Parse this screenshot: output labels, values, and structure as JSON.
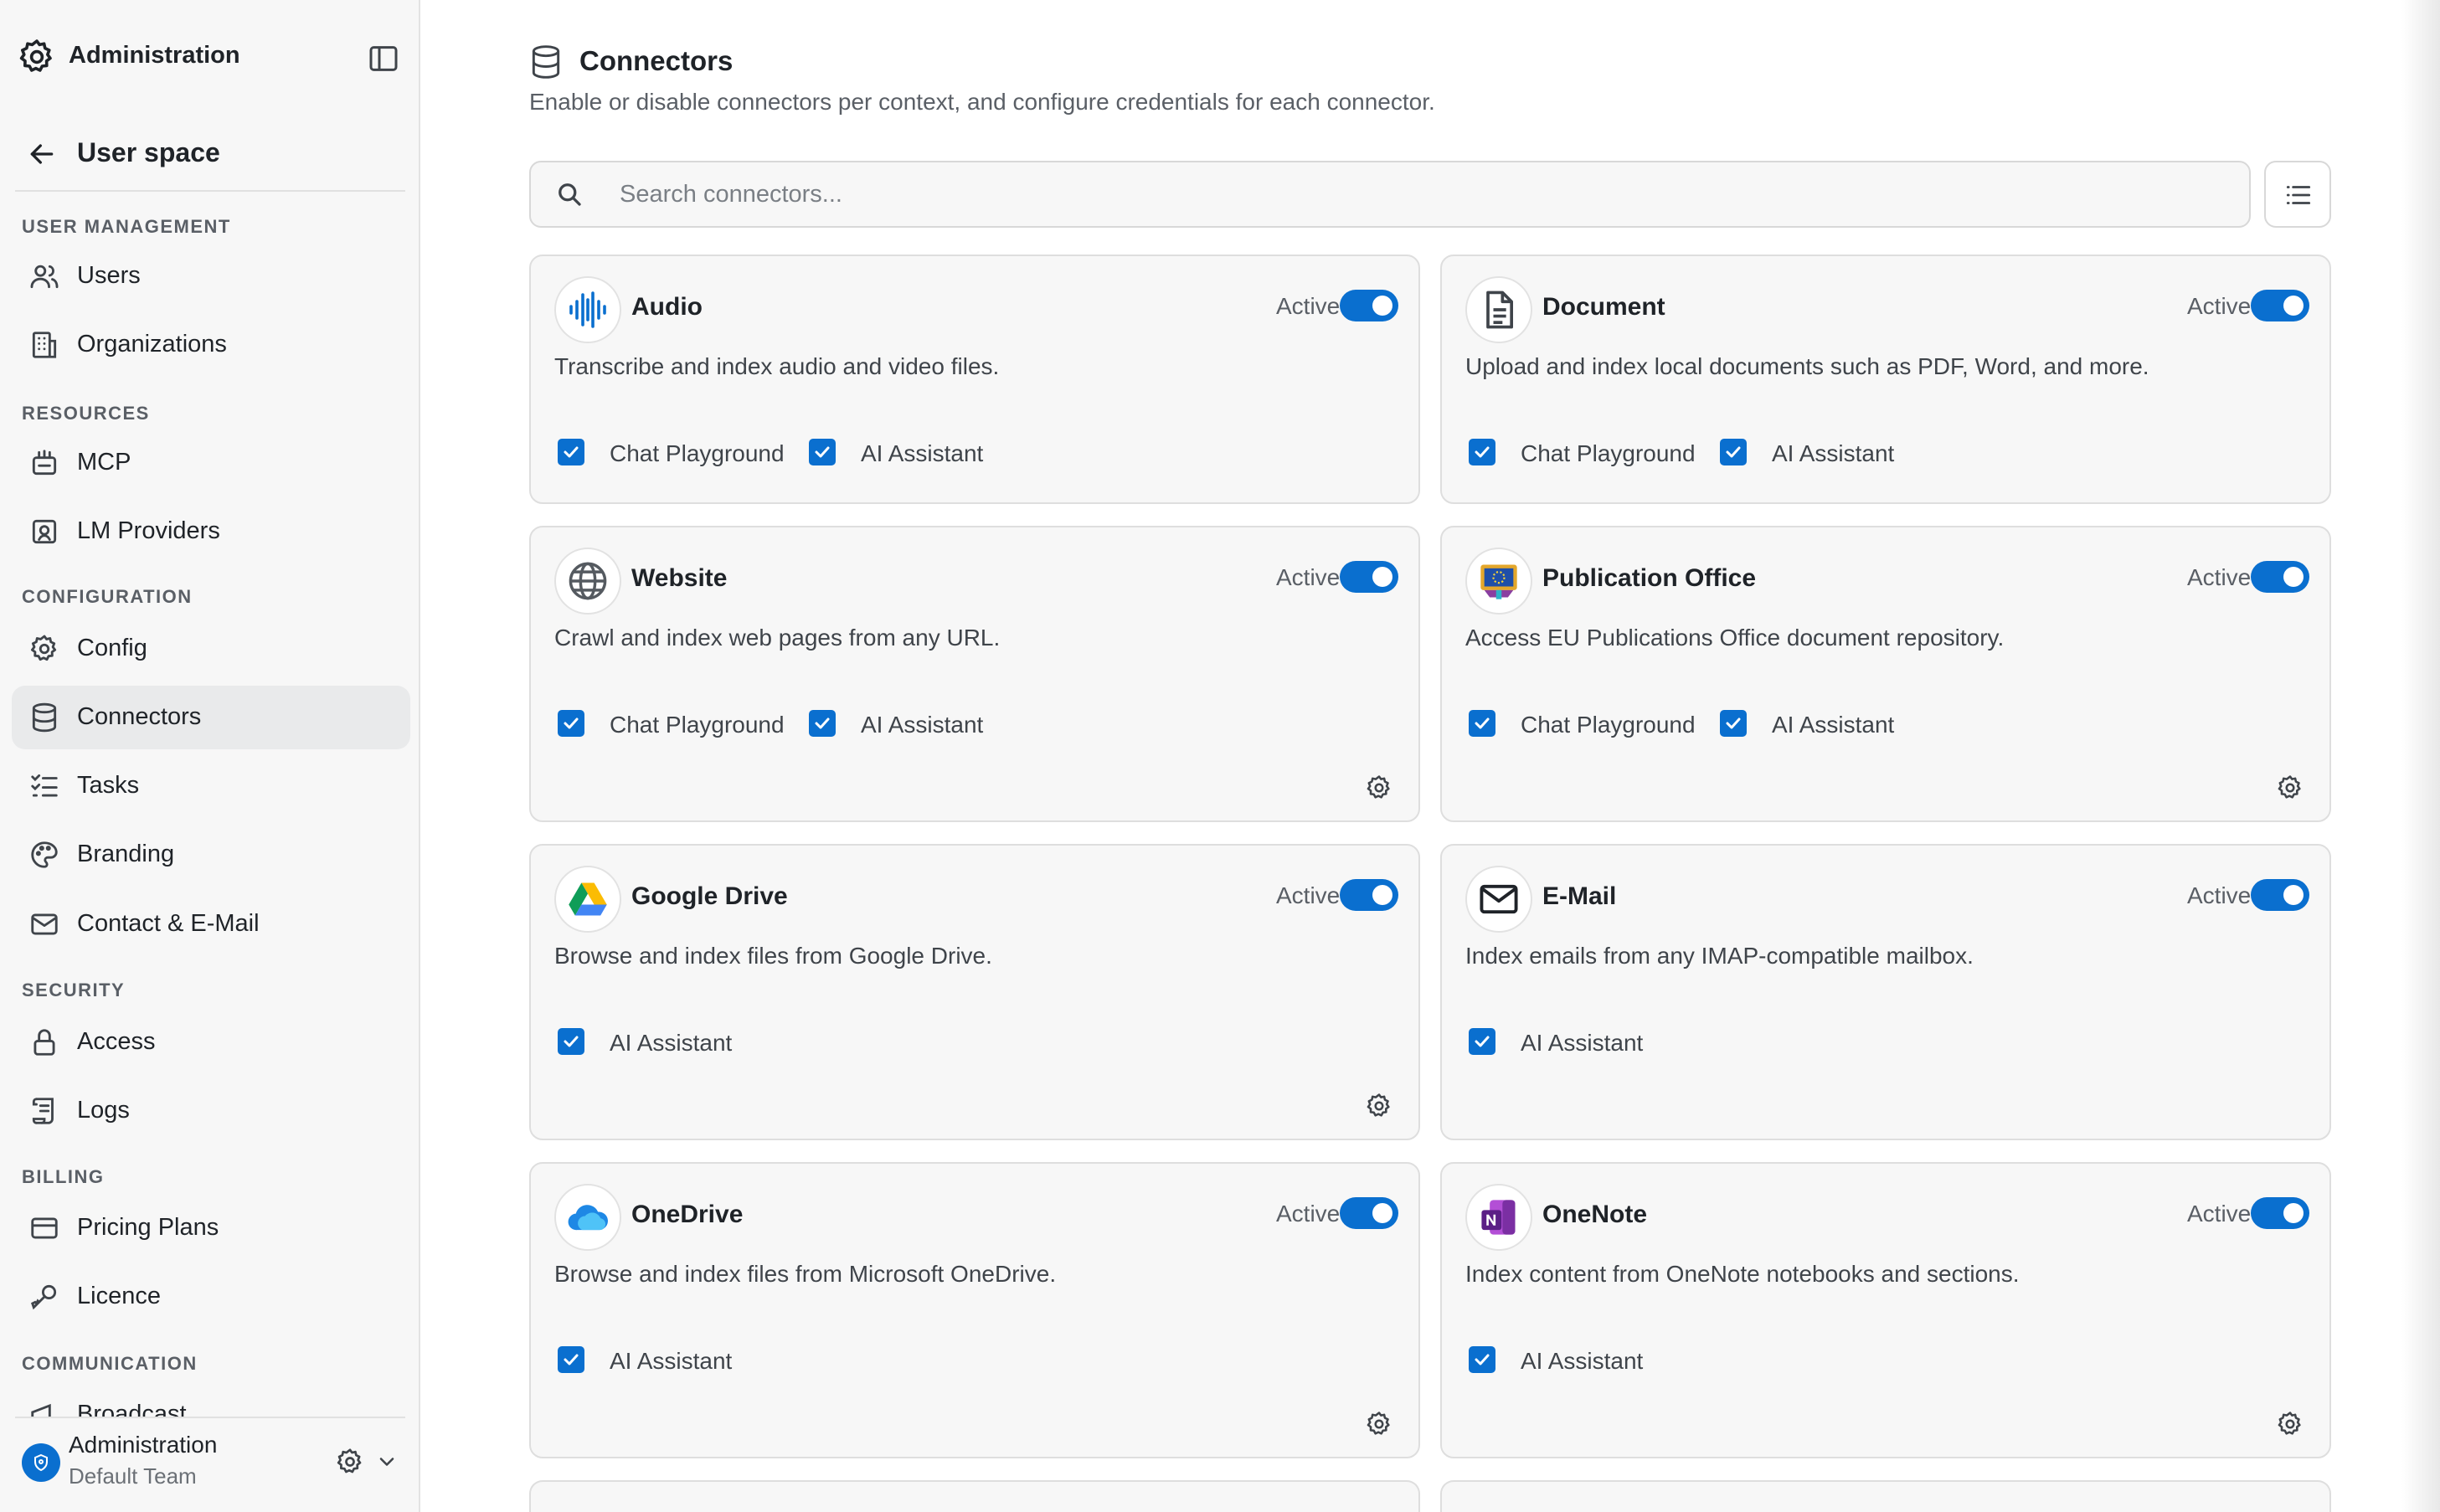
{
  "sidebar": {
    "title": "Administration",
    "back_label": "User space",
    "sections": {
      "user_management": "USER MANAGEMENT",
      "resources": "RESOURCES",
      "configuration": "CONFIGURATION",
      "security": "SECURITY",
      "billing": "BILLING",
      "communication": "COMMUNICATION"
    },
    "items": {
      "users": "Users",
      "organizations": "Organizations",
      "mcp": "MCP",
      "lm_providers": "LM Providers",
      "config": "Config",
      "connectors": "Connectors",
      "tasks": "Tasks",
      "branding": "Branding",
      "contact_email": "Contact & E-Mail",
      "access": "Access",
      "logs": "Logs",
      "pricing_plans": "Pricing Plans",
      "licence": "Licence",
      "broadcast": "Broadcast"
    },
    "active_item": "connectors",
    "footer": {
      "name": "Administration",
      "team": "Default Team"
    }
  },
  "page": {
    "title": "Connectors",
    "subtitle": "Enable or disable connectors per context, and configure credentials for each connector.",
    "search_placeholder": "Search connectors..."
  },
  "connectors": [
    {
      "name": "Audio",
      "status": "Active",
      "enabled": true,
      "description": "Transcribe and index audio and video files.",
      "options": [
        "Chat Playground",
        "AI Assistant"
      ],
      "icon": "audio-wave-icon",
      "has_settings": false
    },
    {
      "name": "Document",
      "status": "Active",
      "enabled": true,
      "description": "Upload and index local documents such as PDF, Word, and more.",
      "options": [
        "Chat Playground",
        "AI Assistant"
      ],
      "icon": "document-icon",
      "has_settings": false
    },
    {
      "name": "Website",
      "status": "Active",
      "enabled": true,
      "description": "Crawl and index web pages from any URL.",
      "options": [
        "Chat Playground",
        "AI Assistant"
      ],
      "icon": "globe-icon",
      "has_settings": true
    },
    {
      "name": "Publication Office",
      "status": "Active",
      "enabled": true,
      "description": "Access EU Publications Office document repository.",
      "options": [
        "Chat Playground",
        "AI Assistant"
      ],
      "icon": "eu-publications-icon",
      "has_settings": true
    },
    {
      "name": "Google Drive",
      "status": "Active",
      "enabled": true,
      "description": "Browse and index files from Google Drive.",
      "options": [
        "AI Assistant"
      ],
      "icon": "google-drive-icon",
      "has_settings": true
    },
    {
      "name": "E-Mail",
      "status": "Active",
      "enabled": true,
      "description": "Index emails from any IMAP-compatible mailbox.",
      "options": [
        "AI Assistant"
      ],
      "icon": "mail-icon",
      "has_settings": false
    },
    {
      "name": "OneDrive",
      "status": "Active",
      "enabled": true,
      "description": "Browse and index files from Microsoft OneDrive.",
      "options": [
        "AI Assistant"
      ],
      "icon": "onedrive-icon",
      "has_settings": true
    },
    {
      "name": "OneNote",
      "status": "Active",
      "enabled": true,
      "description": "Index content from OneNote notebooks and sections.",
      "options": [
        "AI Assistant"
      ],
      "icon": "onenote-icon",
      "has_settings": true
    }
  ],
  "colors": {
    "accent": "#0a6fcf",
    "card_bg": "#f7f7f7",
    "sidebar_bg": "#f7f7f7"
  }
}
